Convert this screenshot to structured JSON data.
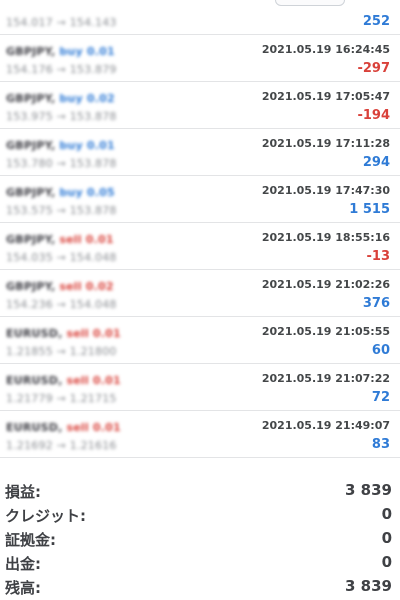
{
  "deals": [
    {
      "symbol": "",
      "direction": "",
      "direction_type": "",
      "prices": "154.017 → 154.143",
      "time": "",
      "profit": "252",
      "profit_sign": "pos"
    },
    {
      "symbol": "GBPJPY,",
      "direction": "buy 0.01",
      "direction_type": "buy",
      "prices": "154.176 → 153.879",
      "time": "2021.05.19 16:24:45",
      "profit": "-297",
      "profit_sign": "neg"
    },
    {
      "symbol": "GBPJPY,",
      "direction": "buy 0.02",
      "direction_type": "buy",
      "prices": "153.975 → 153.878",
      "time": "2021.05.19 17:05:47",
      "profit": "-194",
      "profit_sign": "neg"
    },
    {
      "symbol": "GBPJPY,",
      "direction": "buy 0.01",
      "direction_type": "buy",
      "prices": "153.780 → 153.878",
      "time": "2021.05.19 17:11:28",
      "profit": "294",
      "profit_sign": "pos"
    },
    {
      "symbol": "GBPJPY,",
      "direction": "buy 0.05",
      "direction_type": "buy",
      "prices": "153.575 → 153.878",
      "time": "2021.05.19 17:47:30",
      "profit": "1 515",
      "profit_sign": "pos"
    },
    {
      "symbol": "GBPJPY,",
      "direction": "sell 0.01",
      "direction_type": "sell",
      "prices": "154.035 → 154.048",
      "time": "2021.05.19 18:55:16",
      "profit": "-13",
      "profit_sign": "neg"
    },
    {
      "symbol": "GBPJPY,",
      "direction": "sell 0.02",
      "direction_type": "sell",
      "prices": "154.236 → 154.048",
      "time": "2021.05.19 21:02:26",
      "profit": "376",
      "profit_sign": "pos"
    },
    {
      "symbol": "EURUSD,",
      "direction": "sell 0.01",
      "direction_type": "sell",
      "prices": "1.21855 → 1.21800",
      "time": "2021.05.19 21:05:55",
      "profit": "60",
      "profit_sign": "pos"
    },
    {
      "symbol": "EURUSD,",
      "direction": "sell 0.01",
      "direction_type": "sell",
      "prices": "1.21779 → 1.21715",
      "time": "2021.05.19 21:07:22",
      "profit": "72",
      "profit_sign": "pos"
    },
    {
      "symbol": "EURUSD,",
      "direction": "sell 0.01",
      "direction_type": "sell",
      "prices": "1.21692 → 1.21616",
      "time": "2021.05.19 21:49:07",
      "profit": "83",
      "profit_sign": "pos"
    }
  ],
  "summary": [
    {
      "label": "損益:",
      "value": "3 839"
    },
    {
      "label": "クレジット:",
      "value": "0"
    },
    {
      "label": "証拠金:",
      "value": "0"
    },
    {
      "label": "出金:",
      "value": "0"
    },
    {
      "label": "残高:",
      "value": "3 839"
    }
  ],
  "colors": {
    "positive": "#2f7bd6",
    "negative": "#d9413a",
    "text": "#3f4145"
  }
}
